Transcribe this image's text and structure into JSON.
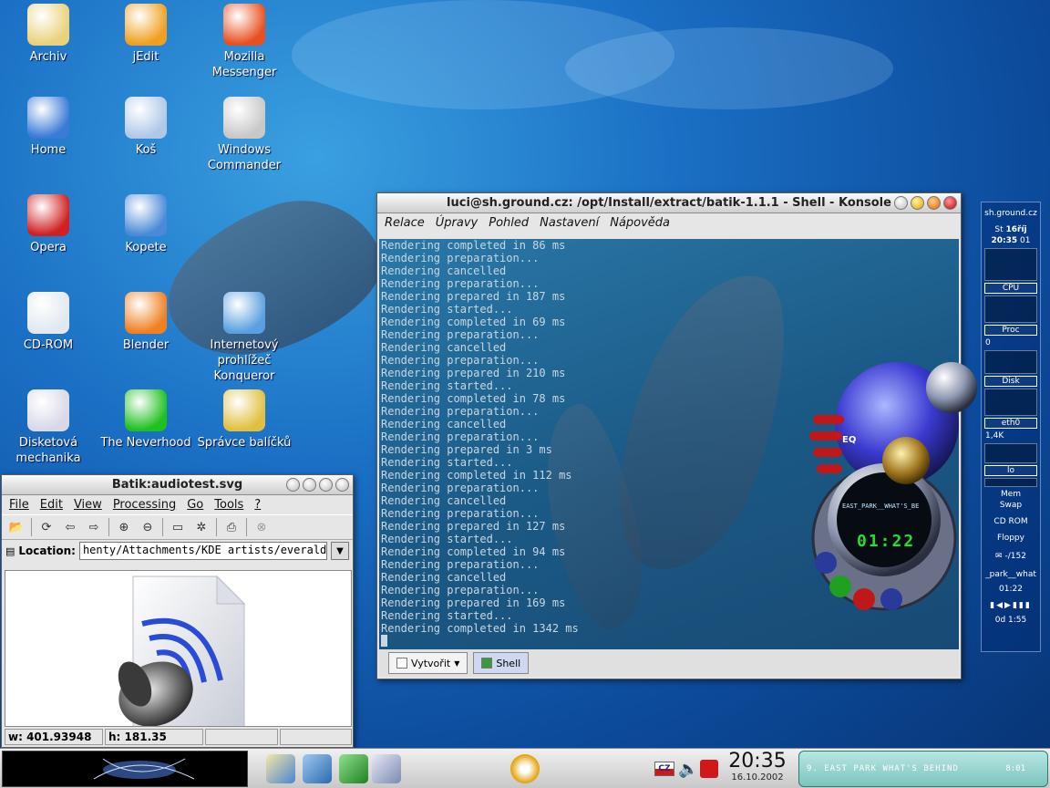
{
  "desktop": {
    "icons": [
      {
        "label": "Archiv",
        "icon": "archive-icon",
        "color": "#e9d27a"
      },
      {
        "label": "jEdit",
        "icon": "jedit-icon",
        "color": "#f0a020"
      },
      {
        "label": "Mozilla Messenger",
        "icon": "mozilla-messenger-icon",
        "color": "#e85020"
      },
      {
        "label": "Home",
        "icon": "home-icon",
        "color": "#3b7bd8"
      },
      {
        "label": "Koš",
        "icon": "trash-icon",
        "color": "#b0c8e8"
      },
      {
        "label": "Windows Commander",
        "icon": "floppy-icon",
        "color": "#c8c8c8"
      },
      {
        "label": "Opera",
        "icon": "opera-icon",
        "color": "#d02020"
      },
      {
        "label": "Kopete",
        "icon": "kopete-icon",
        "color": "#4a8ad8"
      },
      {
        "label": "CD-ROM",
        "icon": "cdrom-icon",
        "color": "#e0e8f0"
      },
      {
        "label": "Blender",
        "icon": "blender-icon",
        "color": "#f08020"
      },
      {
        "label": "Internetový prohlížeč Konqueror",
        "icon": "konqueror-icon",
        "color": "#5aa0e0"
      },
      {
        "label": "Disketová mechanika",
        "icon": "floppy-drive-icon",
        "color": "#d8d8e8"
      },
      {
        "label": "The Neverhood",
        "icon": "neverhood-icon",
        "color": "#20c020"
      },
      {
        "label": "Správce balíčků",
        "icon": "package-manager-icon",
        "color": "#e0c040"
      }
    ]
  },
  "konsole": {
    "title": "luci@sh.ground.cz: /opt/Install/extract/batik-1.1.1 - Shell - Konsole",
    "menu": [
      "Relace",
      "Úpravy",
      "Pohled",
      "Nastavení",
      "Nápověda"
    ],
    "lines": [
      "Rendering completed in 86 ms",
      "Rendering preparation...",
      "Rendering cancelled",
      "Rendering preparation...",
      "Rendering prepared in 187 ms",
      "Rendering started...",
      "Rendering completed in 69 ms",
      "Rendering preparation...",
      "Rendering cancelled",
      "Rendering preparation...",
      "Rendering prepared in 210 ms",
      "Rendering started...",
      "Rendering completed in 78 ms",
      "Rendering preparation...",
      "Rendering cancelled",
      "Rendering preparation...",
      "Rendering prepared in 3 ms",
      "Rendering started...",
      "Rendering completed in 112 ms",
      "Rendering preparation...",
      "Rendering cancelled",
      "Rendering preparation...",
      "Rendering prepared in 127 ms",
      "Rendering started...",
      "Rendering completed in 94 ms",
      "Rendering preparation...",
      "Rendering cancelled",
      "Rendering preparation...",
      "Rendering prepared in 169 ms",
      "Rendering started...",
      "Rendering completed in 1342 ms"
    ],
    "tabs": {
      "new": "Vytvořit",
      "shell": "Shell"
    }
  },
  "batik": {
    "title": "Batik:audiotest.svg",
    "menu": [
      "File",
      "Edit",
      "View",
      "Processing",
      "Go",
      "Tools",
      "?"
    ],
    "location_label": "Location:",
    "location_value": "henty/Attachments/KDE artists/everaldo/au",
    "status_w": "w: 401.93948",
    "status_h": "h: 181.35"
  },
  "sysmon": {
    "host": "sh.ground.cz",
    "day": "St",
    "date": "16říj",
    "time": "20:35",
    "seconds": "01",
    "cpu": "CPU",
    "proc": "Proc",
    "proc_val": "0",
    "disk": "Disk",
    "eth": "eth0",
    "eth_rate": "1,4K",
    "lo": "lo",
    "mem": "Mem",
    "swap": "Swap",
    "cdrom": "CD ROM",
    "floppy": "Floppy",
    "mail": "-/152",
    "track": "_park__what",
    "track_time": "01:22",
    "uptime": "0d  1:55"
  },
  "player": {
    "song": "EAST_PARK__WHAT'S_BE",
    "time": "01:22",
    "eq": "EQ"
  },
  "taskbar": {
    "clock_time": "20:35",
    "clock_date": "16.10.2002",
    "keyboard": "CZ",
    "np_track": "9. EAST PARK  WHAT'S BEHIND",
    "np_time": "8:01"
  }
}
